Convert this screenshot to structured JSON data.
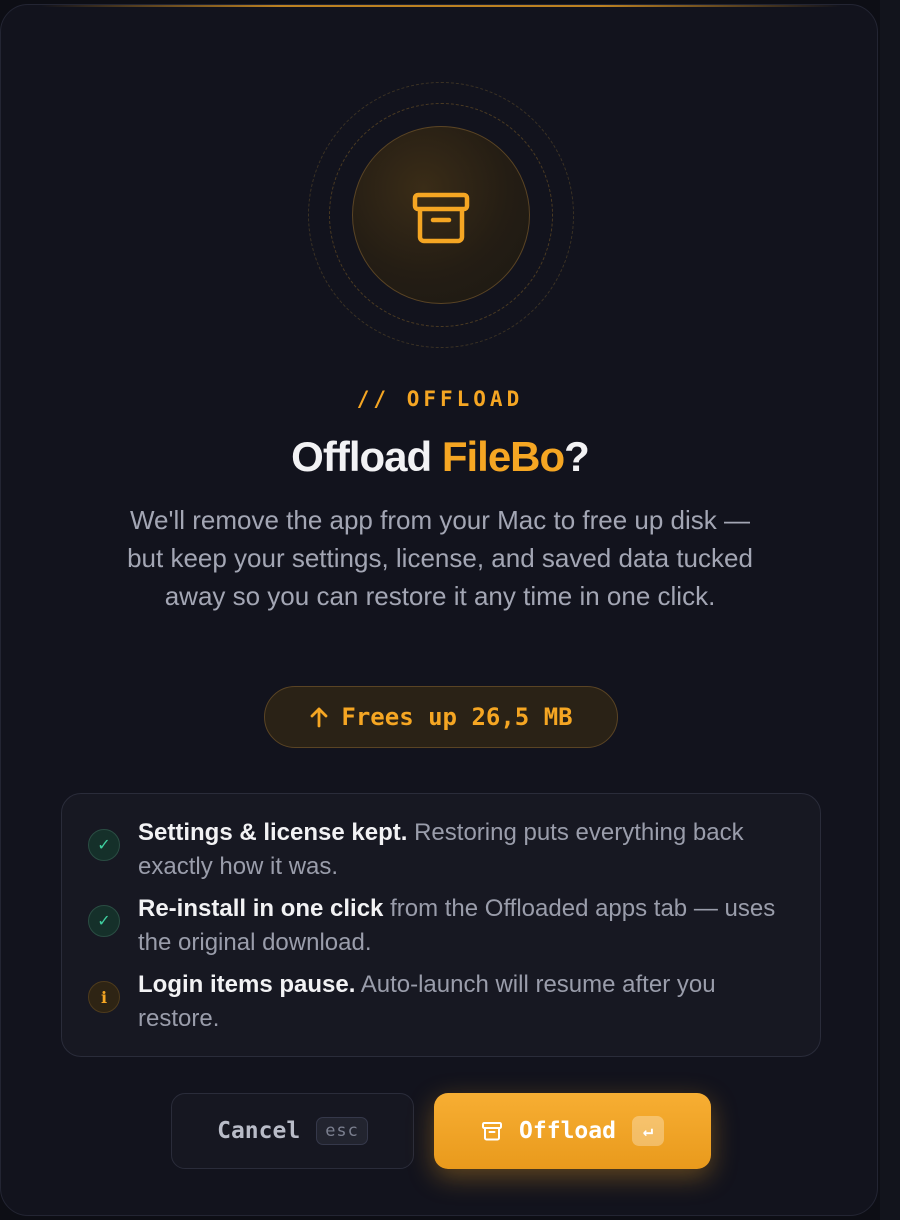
{
  "dialog": {
    "eyebrow": "// OFFLOAD",
    "title_prefix": "Offload ",
    "app_name": "FileBo",
    "title_suffix": "?",
    "description": "We'll remove the app from your Mac to free up disk — but keep your settings, license, and saved data tucked away so you can restore it any time in one click.",
    "frees": {
      "icon": "arrow-up",
      "label": "Frees up 26,5 MB"
    },
    "notes": [
      {
        "status": "ok",
        "icon": "check",
        "bold": "Settings & license kept.",
        "text": " Restoring puts everything back exactly how it was."
      },
      {
        "status": "ok",
        "icon": "check",
        "bold": "Re-install in one click",
        "text": " from the Offloaded apps tab — uses the original download."
      },
      {
        "status": "info",
        "icon": "info",
        "bold": "Login items pause.",
        "text": " Auto-launch will resume after you restore."
      }
    ],
    "buttons": {
      "cancel_label": "Cancel",
      "cancel_shortcut": "esc",
      "offload_label": "Offload",
      "offload_shortcut": "↵"
    },
    "colors": {
      "accent": "#f5a623",
      "success": "#3fd0a0",
      "background": "#12131d"
    }
  }
}
